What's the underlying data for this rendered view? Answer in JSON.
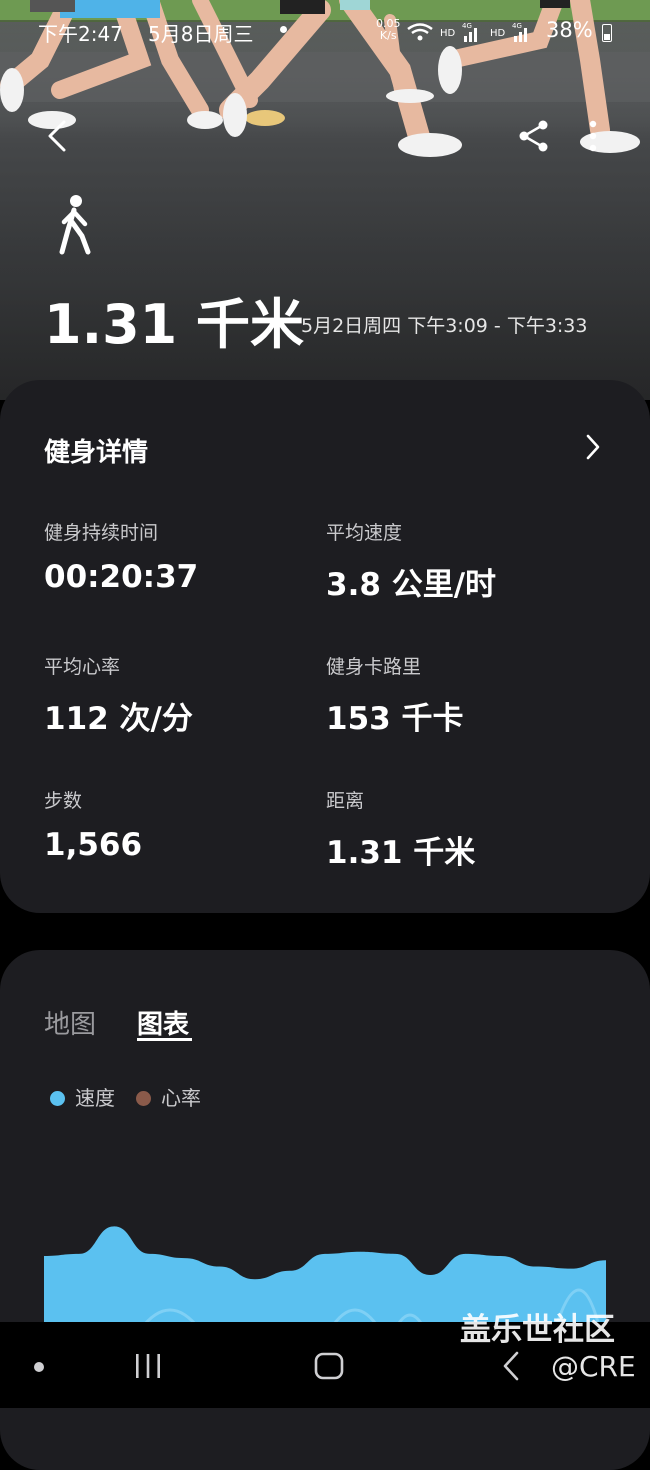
{
  "status_bar": {
    "time": "下午2:47",
    "date": "5月8日周三",
    "net_speed_value": "0.05",
    "net_speed_unit": "K/s",
    "signal_labels": "HD 4G HD 4G",
    "battery": "38%"
  },
  "header": {
    "back_icon": "chevron-left-icon",
    "share_icon": "share-icon",
    "more_icon": "more-vertical-icon",
    "activity_icon": "walking-person-icon",
    "distance": "1.31 千米",
    "session_time": "5月2日周四 下午3:09 - 下午3:33"
  },
  "details": {
    "title": "健身详情",
    "chevron_icon": "chevron-right-icon",
    "stats": [
      {
        "label": "健身持续时间",
        "value": "00:20:37"
      },
      {
        "label": "平均速度",
        "value": "3.8 公里/时"
      },
      {
        "label": "平均心率",
        "value": "112 次/分"
      },
      {
        "label": "健身卡路里",
        "value": "153 千卡"
      },
      {
        "label": "步数",
        "value": "1,566"
      },
      {
        "label": "距离",
        "value": "1.31 千米"
      }
    ]
  },
  "chart_section": {
    "tabs": [
      {
        "label": "地图",
        "active": false
      },
      {
        "label": "图表",
        "active": true
      }
    ],
    "legend": [
      {
        "label": "速度",
        "color": "#5bc1f0"
      },
      {
        "label": "心率",
        "color": "#8a5a4a"
      }
    ]
  },
  "chart_data": {
    "type": "area",
    "series": [
      {
        "name": "速度",
        "values": [
          3.5,
          3.6,
          4.9,
          3.6,
          3.4,
          3.0,
          2.4,
          2.8,
          3.6,
          3.7,
          3.6,
          2.6,
          3.6,
          3.5,
          3.0,
          2.9,
          3.3
        ]
      }
    ],
    "colors": {
      "area": "#5bc1f0",
      "area_light": "#8fd6f7"
    }
  },
  "navigation_bar": {
    "recent_icon": "recent-apps-icon",
    "home_icon": "home-icon",
    "back_icon": "back-icon"
  },
  "watermark": {
    "line1": "盖乐世社区",
    "line2": "@CRE"
  }
}
